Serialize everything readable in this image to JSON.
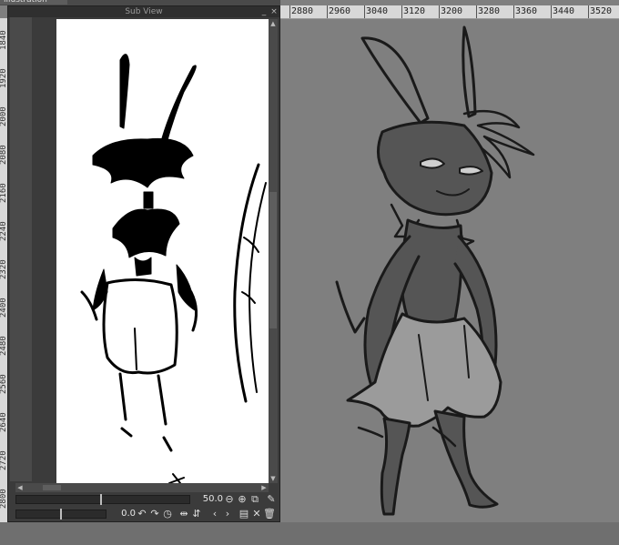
{
  "document_tab": {
    "label": "illustration"
  },
  "top_ruler": {
    "labels": [
      "2880",
      "2960",
      "3040",
      "3120",
      "3200",
      "3280",
      "3360",
      "3440",
      "3520"
    ]
  },
  "left_ruler": {
    "labels": [
      "1840",
      "1920",
      "2000",
      "2080",
      "2160",
      "2240",
      "2320",
      "2400",
      "2480",
      "2560",
      "2640",
      "2720",
      "2800"
    ]
  },
  "subview": {
    "title": "Sub View",
    "minimize_label": "_",
    "close_label": "×",
    "zoom_value": "50.0",
    "rotation_value": "0.0"
  },
  "icons": {
    "zoom_out": "minus-circle-icon",
    "zoom_in": "plus-circle-icon",
    "fit": "fit-window-icon",
    "eyedropper": "eyedropper-icon",
    "rotate_left": "rotate-left-icon",
    "rotate_right": "rotate-right-icon",
    "reset_rotation": "reset-rotation-icon",
    "flip_horizontal": "flip-horizontal-icon",
    "flip_vertical": "flip-vertical-icon",
    "previous": "previous-icon",
    "next": "next-icon",
    "import": "import-folder-icon",
    "clear": "clear-icon",
    "delete": "trash-icon"
  },
  "colors": {
    "workspace": "#7f7f7f",
    "panel": "#3b3b3b",
    "reference_bg": "#ffffff",
    "character_fill": "#555555"
  }
}
